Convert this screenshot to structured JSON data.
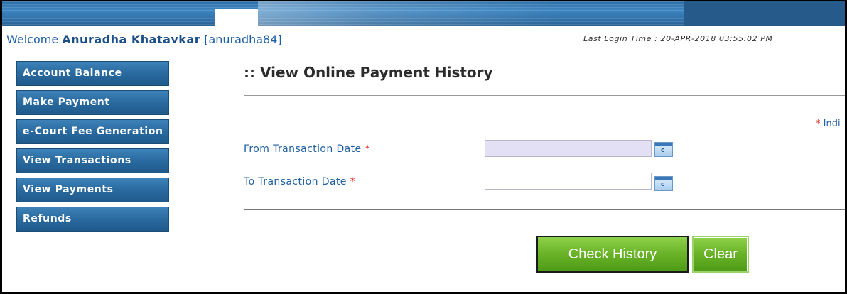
{
  "header": {
    "welcome_prefix": "Welcome",
    "user_name": "Anuradha Khatavkar",
    "user_id": "[anuradha84]",
    "last_login_label": "Last Login Time :",
    "last_login_value": "20-APR-2018 03:55:02 PM"
  },
  "sidebar": {
    "items": [
      {
        "label": "Account Balance"
      },
      {
        "label": "Make Payment"
      },
      {
        "label": "e-Court Fee Generation"
      },
      {
        "label": "View Transactions"
      },
      {
        "label": "View Payments"
      },
      {
        "label": "Refunds"
      }
    ]
  },
  "main": {
    "title": ":: View Online Payment History",
    "indicates_star": "*",
    "indicates_text": "Indi",
    "fields": {
      "from_label": "From Transaction Date",
      "to_label": "To Transaction Date",
      "required_mark": "*",
      "from_value": "",
      "to_value": ""
    },
    "buttons": {
      "check_history": "Check History",
      "clear": "Clear"
    }
  },
  "icons": {
    "calendar": "calendar-icon"
  },
  "colors": {
    "menu_blue": "#2a6a9f",
    "label_blue": "#2060a0",
    "required_red": "#e02020",
    "button_green": "#6cb52a"
  }
}
